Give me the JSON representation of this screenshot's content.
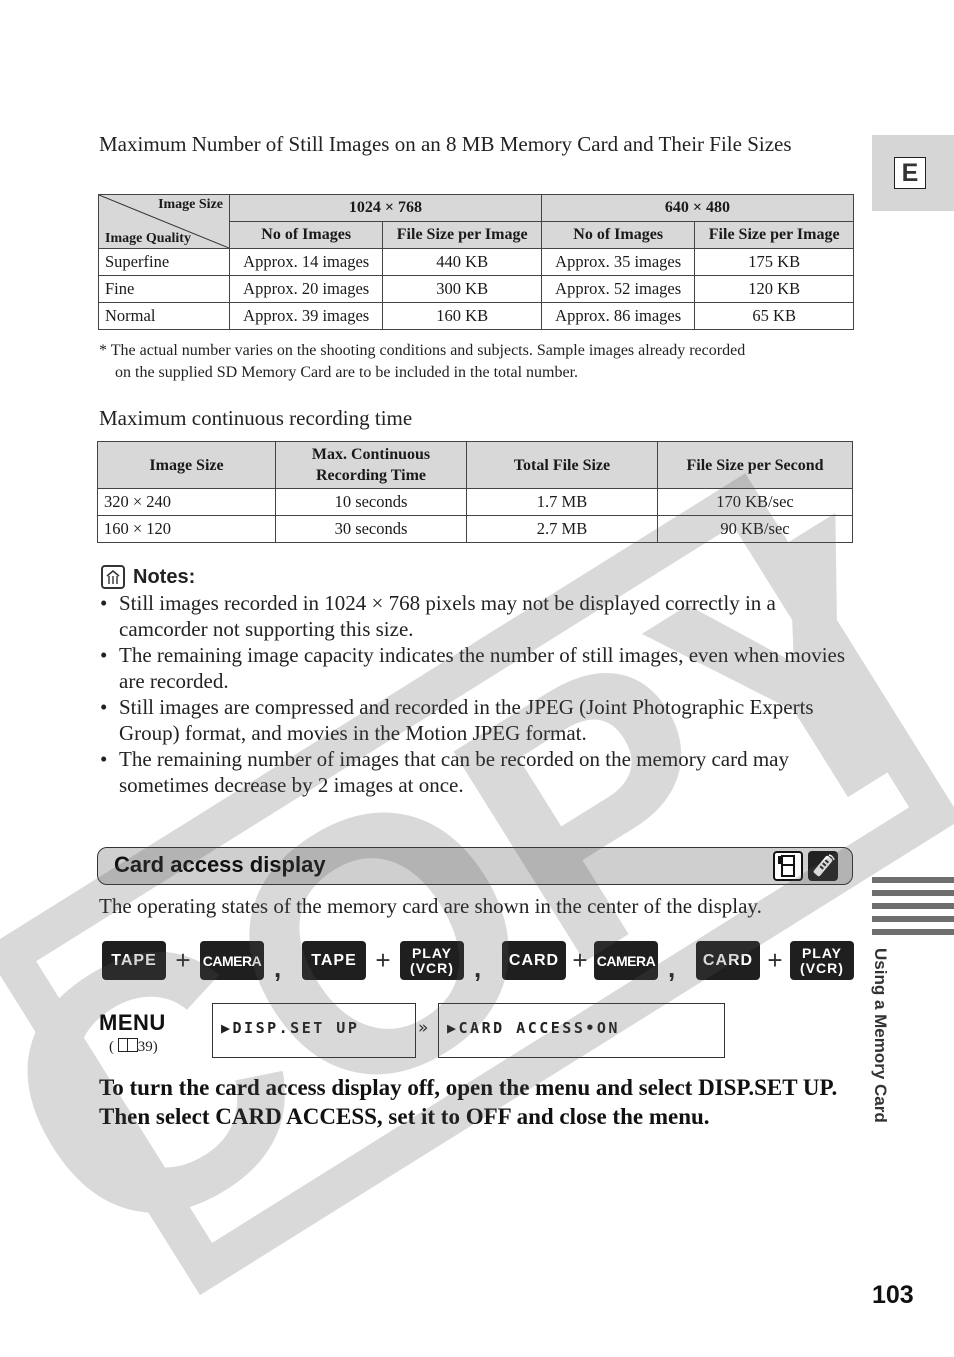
{
  "side": {
    "language_tab": "E",
    "section_label": "Using a Memory Card",
    "page_number": "103"
  },
  "still_images": {
    "title": "Maximum Number of Still Images on an 8 MB Memory Card and Their File Sizes",
    "corner_top": "Image Size",
    "corner_bottom": "Image Quality",
    "sizes": [
      "1024 × 768",
      "640 × 480"
    ],
    "subheaders": [
      "No of Images",
      "File Size per Image",
      "No of Images",
      "File Size per Image"
    ],
    "rows": [
      {
        "quality": "Superfine",
        "cells": [
          "Approx. 14 images",
          "440 KB",
          "Approx. 35 images",
          "175 KB"
        ]
      },
      {
        "quality": "Fine",
        "cells": [
          "Approx. 20 images",
          "300 KB",
          "Approx. 52 images",
          "120 KB"
        ]
      },
      {
        "quality": "Normal",
        "cells": [
          "Approx. 39 images",
          "160 KB",
          "Approx. 86 images",
          "65 KB"
        ]
      }
    ],
    "footnote_line1": "* The actual number varies on the shooting conditions and subjects. Sample images already recorded",
    "footnote_line2": "on the supplied SD Memory Card are to be included in the total number."
  },
  "recording": {
    "title": "Maximum continuous recording time",
    "headers": [
      "Image Size",
      "Max. Continuous",
      "Recording Time",
      "Total File Size",
      "File Size per Second"
    ],
    "rows": [
      [
        "320 × 240",
        "10 seconds",
        "1.7 MB",
        "170 KB/sec"
      ],
      [
        "160 × 120",
        "30 seconds",
        "2.7 MB",
        "90 KB/sec"
      ]
    ]
  },
  "notes": {
    "heading": "Notes:",
    "items": [
      "Still images recorded in 1024 × 768 pixels may not be displayed correctly in a camcorder not supporting this size.",
      "The remaining image capacity indicates the number of still images, even when movies are recorded.",
      "Still images are compressed and recorded in the JPEG (Joint Photographic Experts Group) format, and movies in the Motion JPEG format.",
      "The remaining number of images that can be recorded on the memory card may sometimes decrease by 2 images at once."
    ]
  },
  "card_access": {
    "title": "Card access display",
    "description": "The operating states of the memory card are shown in the center of the display.",
    "modes": [
      {
        "a": "TAPE",
        "b": "CAMERA"
      },
      {
        "a": "TAPE",
        "b_line1": "PLAY",
        "b_line2": "(VCR)"
      },
      {
        "a": "CARD",
        "b": "CAMERA"
      },
      {
        "a": "CARD",
        "b_line1": "PLAY",
        "b_line2": "(VCR)"
      }
    ],
    "plus": "+",
    "comma": ",",
    "menu_label": "MENU",
    "menu_ref": "( 📖 39)",
    "menu_ref_page": "39",
    "screen1": "▶DISP.SET UP",
    "screen2": "▶CARD ACCESS•ON",
    "next_arrow": "»",
    "instruction": "To turn the card access display off, open the menu and select DISP.SET UP. Then select CARD ACCESS, set it to OFF and close the menu."
  },
  "watermark": "COPY"
}
